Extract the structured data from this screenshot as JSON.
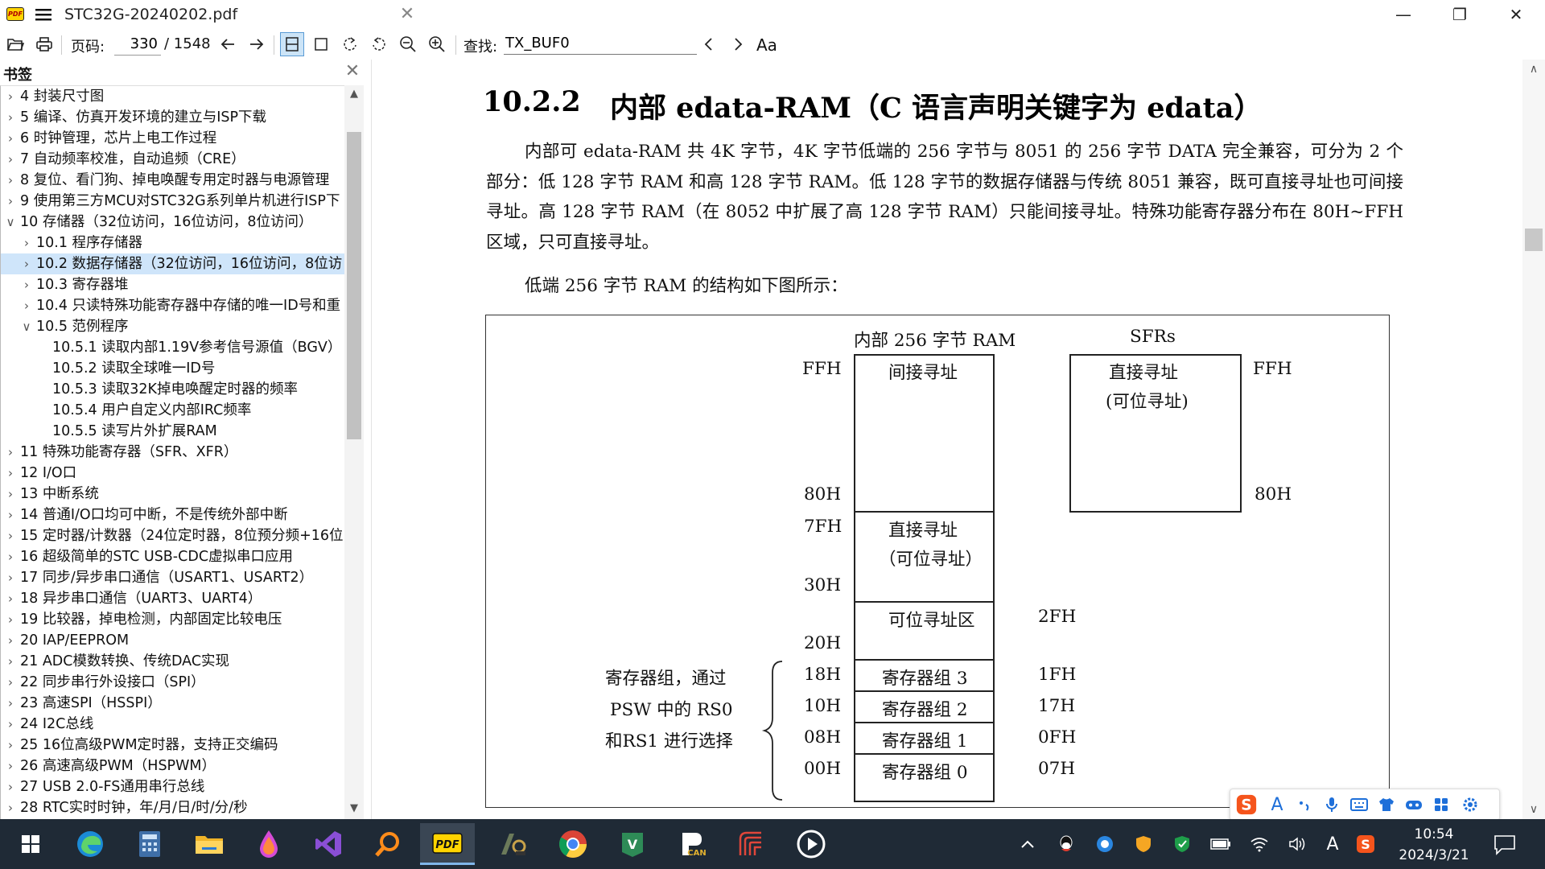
{
  "titlebar": {
    "app_icon_text": "PDF",
    "doc_title": "STC32G-20240202.pdf",
    "tab_close": "✕",
    "minimize": "—",
    "restore": "❐",
    "close": "✕"
  },
  "toolbar": {
    "page_label": "页码:",
    "page_current": "330",
    "page_total": "/ 1548",
    "search_label": "查找:",
    "search_value": "TX_BUF0",
    "match_case": "Aa"
  },
  "sidebar": {
    "title": "书签",
    "close": "✕",
    "items": [
      {
        "label": "4 封装尺寸图",
        "level": 0,
        "expanded": false
      },
      {
        "label": "5 编译、仿真开发环境的建立与ISP下载",
        "level": 0,
        "expanded": false
      },
      {
        "label": "6 时钟管理，芯片上电工作过程",
        "level": 0,
        "expanded": false
      },
      {
        "label": "7 自动频率校准，自动追频（CRE）",
        "level": 0,
        "expanded": false
      },
      {
        "label": "8 复位、看门狗、掉电唤醒专用定时器与电源管理",
        "level": 0,
        "expanded": false
      },
      {
        "label": "9 使用第三方MCU对STC32G系列单片机进行ISP下",
        "level": 0,
        "expanded": false
      },
      {
        "label": "10 存储器（32位访问，16位访问，8位访问）",
        "level": 0,
        "expanded": true
      },
      {
        "label": "10.1 程序存储器",
        "level": 1,
        "expanded": false
      },
      {
        "label": "10.2 数据存储器（32位访问，16位访问，8位访",
        "level": 1,
        "expanded": false,
        "selected": true
      },
      {
        "label": "10.3 寄存器堆",
        "level": 1,
        "expanded": false
      },
      {
        "label": "10.4 只读特殊功能寄存器中存储的唯一ID号和重",
        "level": 1,
        "expanded": false
      },
      {
        "label": "10.5 范例程序",
        "level": 1,
        "expanded": true
      },
      {
        "label": "10.5.1 读取内部1.19V参考信号源值（BGV）",
        "level": 2
      },
      {
        "label": "10.5.2 读取全球唯一ID号",
        "level": 2
      },
      {
        "label": "10.5.3 读取32K掉电唤醒定时器的频率",
        "level": 2
      },
      {
        "label": "10.5.4 用户自定义内部IRC频率",
        "level": 2
      },
      {
        "label": "10.5.5 读写片外扩展RAM",
        "level": 2
      },
      {
        "label": "11 特殊功能寄存器（SFR、XFR）",
        "level": 0,
        "expanded": false
      },
      {
        "label": "12 I/O口",
        "level": 0,
        "expanded": false
      },
      {
        "label": "13 中断系统",
        "level": 0,
        "expanded": false
      },
      {
        "label": "14 普通I/O口均可中断，不是传统外部中断",
        "level": 0,
        "expanded": false
      },
      {
        "label": "15 定时器/计数器（24位定时器，8位预分频+16位",
        "level": 0,
        "expanded": false
      },
      {
        "label": "16 超级简单的STC USB-CDC虚拟串口应用",
        "level": 0,
        "expanded": false
      },
      {
        "label": "17 同步/异步串口通信（USART1、USART2）",
        "level": 0,
        "expanded": false
      },
      {
        "label": "18 异步串口通信（UART3、UART4）",
        "level": 0,
        "expanded": false
      },
      {
        "label": "19 比较器，掉电检测，内部固定比较电压",
        "level": 0,
        "expanded": false
      },
      {
        "label": "20 IAP/EEPROM",
        "level": 0,
        "expanded": false
      },
      {
        "label": "21 ADC模数转换、传统DAC实现",
        "level": 0,
        "expanded": false
      },
      {
        "label": "22 同步串行外设接口（SPI）",
        "level": 0,
        "expanded": false
      },
      {
        "label": "23 高速SPI（HSSPI）",
        "level": 0,
        "expanded": false
      },
      {
        "label": "24 I2C总线",
        "level": 0,
        "expanded": false
      },
      {
        "label": "25 16位高级PWM定时器，支持正交编码",
        "level": 0,
        "expanded": false
      },
      {
        "label": "26 高速高级PWM（HSPWM）",
        "level": 0,
        "expanded": false
      },
      {
        "label": "27 USB 2.0-FS通用串行总线",
        "level": 0,
        "expanded": false
      },
      {
        "label": "28 RTC实时时钟，年/月/日/时/分/秒",
        "level": 0,
        "expanded": false
      }
    ]
  },
  "document": {
    "heading_num": "10.2.2",
    "heading_text": "内部 edata-RAM（C 语言声明关键字为 edata）",
    "paragraph1": "内部可 edata-RAM 共 4K 字节，4K 字节低端的 256 字节与 8051 的 256 字节 DATA 完全兼容，可分为 2 个部分：低 128 字节 RAM 和高 128 字节 RAM。低 128 字节的数据存储器与传统 8051 兼容，既可直接寻址也可间接寻址。高 128 字节 RAM（在 8052 中扩展了高 128 字节 RAM）只能间接寻址。特殊功能寄存器分布在 80H~FFH 区域，只可直接寻址。",
    "paragraph2": "低端 256 字节 RAM 的结构如下图所示：",
    "diagram": {
      "ram_title": "内部 256 字节 RAM",
      "sfr_title": "SFRs",
      "ram_indirect": "间接寻址",
      "ram_direct_1": "直接寻址",
      "ram_direct_2": "（可位寻址）",
      "bit_area": "可位寻址区",
      "bank3": "寄存器组 3",
      "bank2": "寄存器组 2",
      "bank1": "寄存器组 1",
      "bank0": "寄存器组 0",
      "sfr_direct_1": "直接寻址",
      "sfr_direct_2": "(可位寻址)",
      "left_ffh": "FFH",
      "left_80h": "80H",
      "left_7fh": "7FH",
      "left_30h": "30H",
      "left_20h": "20H",
      "left_18h": "18H",
      "left_10h": "10H",
      "left_08h": "08H",
      "left_00h": "00H",
      "right_2fh": "2FH",
      "right_1fh": "1FH",
      "right_17h": "17H",
      "right_0fh": "0FH",
      "right_07h": "07H",
      "sfr_ffh": "FFH",
      "sfr_80h": "80H",
      "note_1": "寄存器组，通过",
      "note_2": "PSW 中的 RS0",
      "note_3": "和RS1 进行选择"
    }
  },
  "ime": {
    "items": [
      "sogou-logo-icon",
      "A",
      "punctuation-icon",
      "microphone-icon",
      "keyboard-icon",
      "skin-icon",
      "game-icon",
      "toolbox-icon",
      "settings-icon"
    ],
    "letter": "A"
  },
  "taskbar": {
    "clock_time": "10:54",
    "clock_date": "2024/3/21",
    "ime_mode": "A"
  },
  "colors": {
    "selection": "#cfe5fa",
    "taskbar": "#1f2a36",
    "accent": "#5a9bd5"
  }
}
